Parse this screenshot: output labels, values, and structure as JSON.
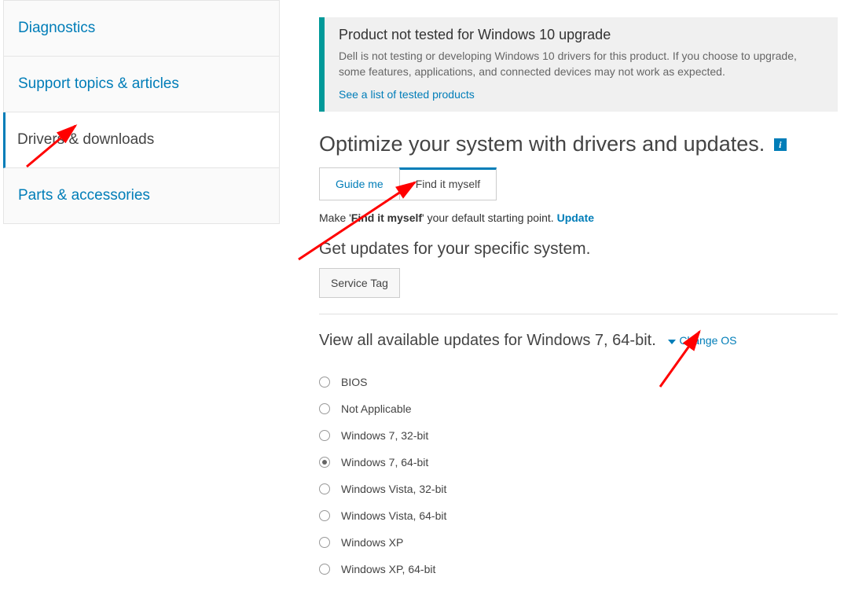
{
  "sidebar": {
    "items": [
      {
        "label": "Diagnostics",
        "active": false
      },
      {
        "label": "Support topics & articles",
        "active": false
      },
      {
        "label": "Drivers & downloads",
        "active": true
      },
      {
        "label": "Parts & accessories",
        "active": false
      }
    ]
  },
  "notice": {
    "title": "Product not tested for Windows 10 upgrade",
    "body": "Dell is not testing or developing Windows 10 drivers for this product. If you choose to upgrade, some features, applications, and connected devices may not work as expected.",
    "link": "See a list of tested products"
  },
  "main": {
    "heading": "Optimize your system with drivers and updates.",
    "tabs": [
      {
        "label": "Guide me",
        "active": false
      },
      {
        "label": "Find it myself",
        "active": true
      }
    ],
    "default_prefix": "Make '",
    "default_bold": "Find it myself",
    "default_suffix": "' your default starting point. ",
    "update_link": "Update",
    "subheading": "Get updates for your specific system.",
    "service_tag_btn": "Service Tag",
    "view_line": "View all available updates for Windows 7, 64-bit.",
    "change_os": "Change OS",
    "os_options": [
      {
        "label": "BIOS",
        "selected": false
      },
      {
        "label": "Not Applicable",
        "selected": false
      },
      {
        "label": "Windows 7, 32-bit",
        "selected": false
      },
      {
        "label": "Windows 7, 64-bit",
        "selected": true
      },
      {
        "label": "Windows Vista, 32-bit",
        "selected": false
      },
      {
        "label": "Windows Vista, 64-bit",
        "selected": false
      },
      {
        "label": "Windows XP",
        "selected": false
      },
      {
        "label": "Windows XP, 64-bit",
        "selected": false
      }
    ]
  }
}
